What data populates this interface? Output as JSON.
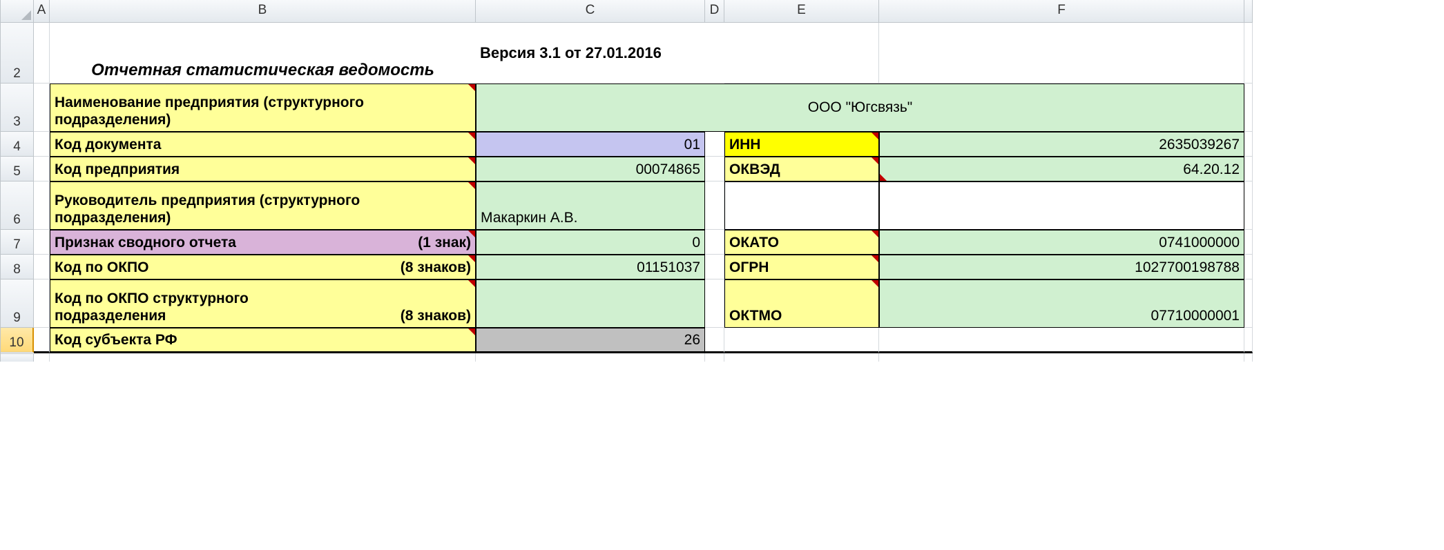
{
  "cols": {
    "A": "A",
    "B": "B",
    "C": "C",
    "D": "D",
    "E": "E",
    "F": "F"
  },
  "rows": [
    "2",
    "3",
    "4",
    "5",
    "6",
    "7",
    "8",
    "9",
    "10"
  ],
  "title": "Отчетная  статистическая ведомость",
  "version": "Версия 3.1 от 27.01.2016",
  "labels": {
    "company_name": "Наименование предприятия (структурного подразделения)",
    "doc_code": "Код документа",
    "ent_code": "Код предприятия",
    "head": "Руководитель предприятия (структурного подразделения)",
    "summary_flag_l": "Признак сводного отчета",
    "summary_flag_r": "(1 знак)",
    "okpo_l": "Код по ОКПО",
    "okpo_r": "(8 знаков)",
    "okpo_struct_l": "Код по ОКПО  структурного подразделения",
    "okpo_struct_r": "(8 знаков)",
    "subj_rf": "Код субъекта РФ",
    "inn": "ИНН",
    "okved": "ОКВЭД",
    "okato": "ОКАТО",
    "ogrn": "ОГРН",
    "oktmo": "ОКТМО"
  },
  "values": {
    "company_name": "ООО \"Югсвязь\"",
    "doc_code": "01",
    "ent_code": "00074865",
    "head": "Макаркин А.В.",
    "summary_flag": "0",
    "okpo": "01151037",
    "okpo_struct": "",
    "subj_rf": "26",
    "inn": "2635039267",
    "okved": "64.20.12",
    "okato": "0741000000",
    "ogrn": "1027700198788",
    "oktmo": "07710000001"
  }
}
